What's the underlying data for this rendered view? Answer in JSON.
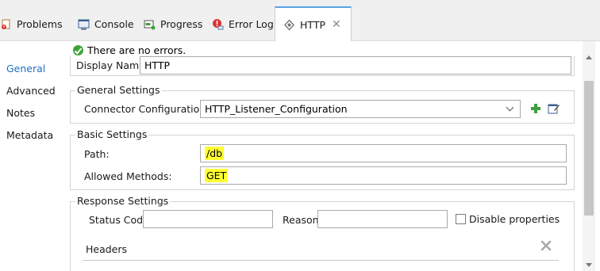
{
  "tabs": [
    {
      "label": "Problems",
      "icon": "problems-icon"
    },
    {
      "label": "Console",
      "icon": "console-icon"
    },
    {
      "label": "Progress",
      "icon": "progress-icon"
    },
    {
      "label": "Error Log",
      "icon": "error-log-icon"
    },
    {
      "label": "HTTP",
      "icon": "http-icon",
      "active": true
    }
  ],
  "tab_close": "✕",
  "nav": {
    "items": [
      {
        "label": "General",
        "active": true
      },
      {
        "label": "Advanced"
      },
      {
        "label": "Notes"
      },
      {
        "label": "Metadata"
      }
    ]
  },
  "status": {
    "message": "There are no errors."
  },
  "display_name": {
    "label": "Display Name:",
    "value": "HTTP"
  },
  "general_settings": {
    "title": "General Settings",
    "connector_label": "Connector Configuration:",
    "connector_value": "HTTP_Listener_Configuration"
  },
  "basic_settings": {
    "title": "Basic Settings",
    "path_label": "Path:",
    "path_value": "/db",
    "methods_label": "Allowed Methods:",
    "methods_value": "GET"
  },
  "response_settings": {
    "title": "Response Settings",
    "status_code_label": "Status Code:",
    "status_code_value": "",
    "reason_label": "Reason:",
    "reason_value": "",
    "disable_label": "Disable properties",
    "headers_label": "Headers"
  },
  "colors": {
    "accent": "#1f6fc5",
    "highlight": "#ffff33",
    "ok": "#3aa53a",
    "add": "#3f9f3f"
  }
}
